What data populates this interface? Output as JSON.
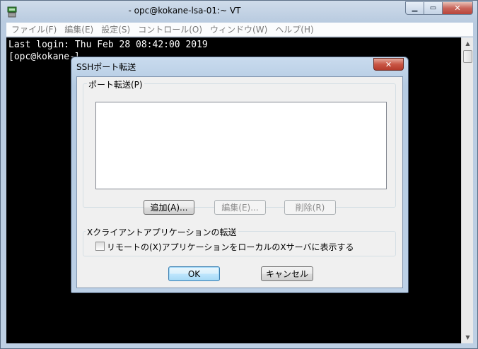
{
  "window": {
    "title": "- opc@kokane-lsa-01:~ VT",
    "minimize": "▁",
    "maximize": "▭",
    "close": "✕"
  },
  "menu": [
    "ファイル(F)",
    "編集(E)",
    "設定(S)",
    "コントロール(O)",
    "ウィンドウ(W)",
    "ヘルプ(H)"
  ],
  "terminal": {
    "lines": [
      "Last login: Thu Feb 28 08:42:00 2019",
      "[opc@kokane-l"
    ]
  },
  "dialog": {
    "title": "SSHポート転送",
    "close": "✕",
    "port_group_label": "ポート転送(P)",
    "add_button": "追加(A)...",
    "edit_button": "編集(E)...",
    "delete_button": "削除(R)",
    "x_group_label": "Xクライアントアプリケーションの転送",
    "x_checkbox_label": "リモートの(X)アプリケーションをローカルのXサーバに表示する",
    "x_checkbox_checked": false,
    "ok_button": "OK",
    "cancel_button": "キャンセル"
  },
  "scrollbar": {
    "up": "▲",
    "down": "▼"
  }
}
